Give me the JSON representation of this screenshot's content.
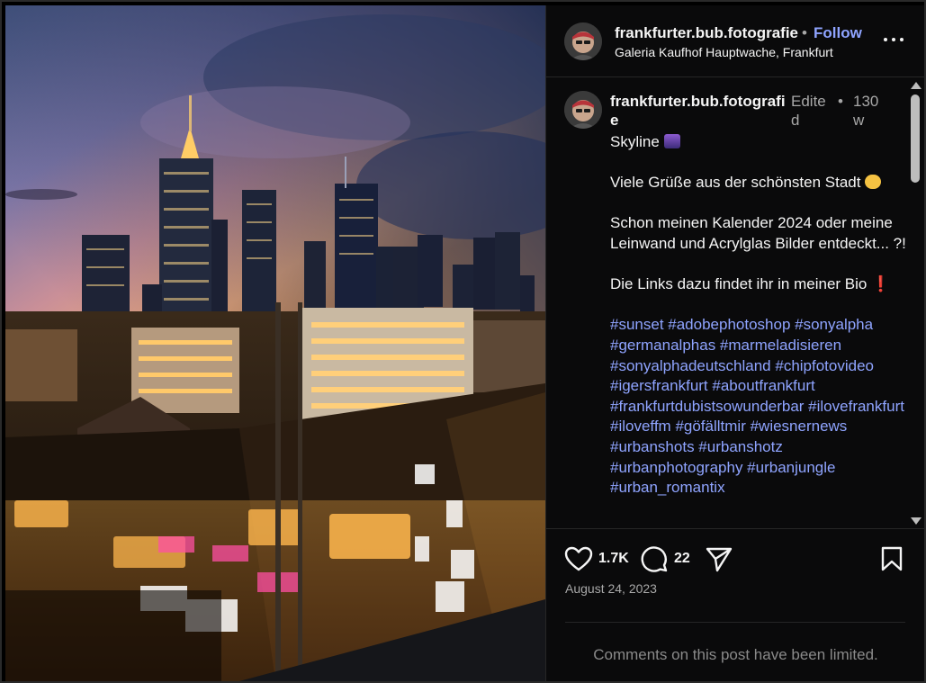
{
  "photo": {
    "subject": "Frankfurt skyline at sunset over a Christmas market",
    "icon": "photo-image"
  },
  "header": {
    "username": "frankfurter.bub.fotografie",
    "separator": "•",
    "follow_label": "Follow",
    "location": "Galeria Kaufhof Hauptwache, Frankfurt",
    "more_icon": "more-dots-icon"
  },
  "caption": {
    "username": "frankfurter.bub.fotografie",
    "edited": "Edited",
    "separator": "•",
    "age": "130w",
    "line1": "Skyline",
    "line2": "Viele Grüße aus der schönsten Stadt",
    "line3": "Schon meinen Kalender 2024 oder meine Leinwand und Acrylglas Bilder entdeckt... ?!",
    "line4": "Die Links dazu findet ihr in meiner Bio",
    "bio_mark": "❗",
    "hashtags": "#sunset #adobephotoshop #sonyalpha #germanalphas #marmeladisieren #sonyalphadeutschland #chipfotovideo #igersfrankfurt #aboutfrankfurt #frankfurtdubistsowunderbar #ilovefrankfurt #iloveffm #göfälltmir #wiesnernews #urbanshots #urbanshotz #urbanphotography #urbanjungle #urban_romantix"
  },
  "actions": {
    "like_count": "1.7K",
    "comment_count": "22",
    "date": "August 24, 2023",
    "comments_limited": "Comments on this post have been limited."
  },
  "colors": {
    "background": "#0a0a0b",
    "link": "#8fa4ff",
    "muted": "#a8a8a8",
    "divider": "#262626"
  }
}
